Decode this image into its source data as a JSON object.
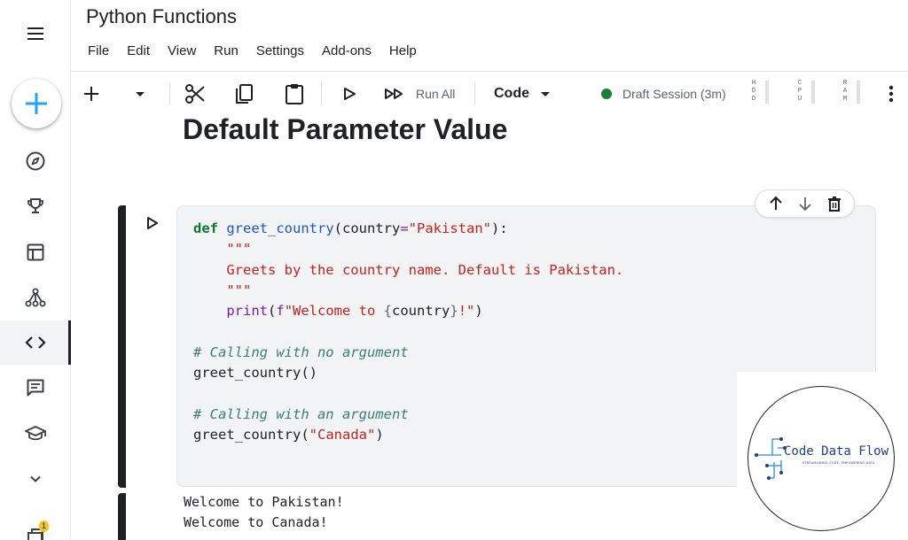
{
  "notebook": {
    "title": "Python Functions"
  },
  "menu": [
    "File",
    "Edit",
    "View",
    "Run",
    "Settings",
    "Add-ons",
    "Help"
  ],
  "toolbar": {
    "run_all_label": "Run All",
    "cell_type": "Code",
    "session": "Draft Session (3m)",
    "meters": [
      {
        "label": "HDD",
        "letters": [
          "H",
          "D",
          "D"
        ]
      },
      {
        "label": "CPU",
        "letters": [
          "C",
          "P",
          "U"
        ]
      },
      {
        "label": "RAM",
        "letters": [
          "R",
          "A",
          "M"
        ]
      }
    ]
  },
  "markdown": {
    "heading": "Default Parameter Value"
  },
  "code_cell": {
    "lines": [
      "def greet_country(country=\"Pakistan\"):",
      "    \"\"\"",
      "    Greets by the country name. Default is Pakistan.",
      "    \"\"\"",
      "    print(f\"Welcome to {country}!\")",
      "",
      "# Calling with no argument",
      "greet_country()",
      "",
      "# Calling with an argument",
      "greet_country(\"Canada\")"
    ]
  },
  "output": {
    "lines": [
      "Welcome to Pakistan!",
      "Welcome to Canada!"
    ]
  },
  "sidebar": {
    "notification_count": "1",
    "items": [
      "compass-icon",
      "trophy-icon",
      "table-icon",
      "network-icon",
      "code-icon",
      "chat-icon",
      "school-icon",
      "chevron-down-icon",
      "notes-icon"
    ]
  },
  "logo": {
    "name": "Code Data Flow",
    "tagline": "STREAMLINING CODE, EMPOWERING DATA"
  },
  "colors": {
    "accent": "#1a73e8",
    "session_dot": "#188038",
    "keyword": "#137333",
    "string": "#c5221f",
    "comment": "#3c7d7a"
  }
}
